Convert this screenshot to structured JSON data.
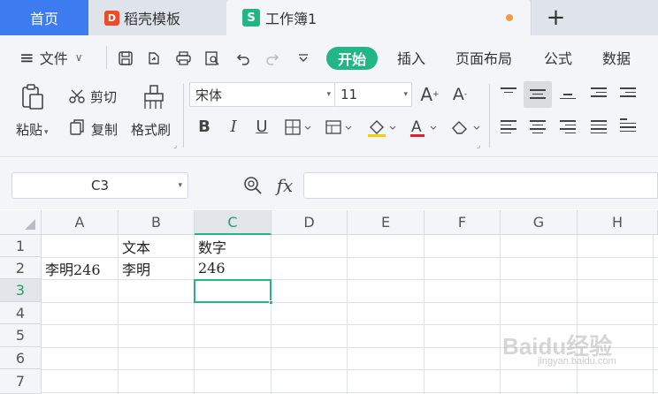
{
  "tabs": {
    "home": "首页",
    "template_logo": "D",
    "template": "稻壳模板",
    "book_logo": "S",
    "book": "工作簿1",
    "plus": "+"
  },
  "menu": {
    "hamburger": "≡",
    "file": "文件",
    "file_arrow": "∨",
    "start": "开始",
    "insert": "插入",
    "page_layout": "页面布局",
    "formula": "公式",
    "data": "数据"
  },
  "ribbon": {
    "cut": "剪切",
    "paste": "粘贴",
    "paste_arrow": "▾",
    "copy": "复制",
    "format_painter": "格式刷",
    "font_name": "宋体",
    "font_size": "11",
    "bold": "B",
    "italic": "I",
    "underline": "U",
    "font_color_letter": "A"
  },
  "formula_bar": {
    "name_box": "C3",
    "fx": "fx",
    "content": ""
  },
  "grid": {
    "columns": [
      "A",
      "B",
      "C",
      "D",
      "E",
      "F",
      "G",
      "H"
    ],
    "rows": [
      "1",
      "2",
      "3",
      "4",
      "5",
      "6",
      "7"
    ],
    "cells": {
      "B1": "文本",
      "C1": "数字",
      "A2": "李明246",
      "B2": "李明",
      "C2": "246"
    },
    "selected_cell": "C3"
  },
  "watermark": {
    "main": "Baidu经验",
    "sub": "jingyan.baidu.com"
  },
  "colors": {
    "accent_green": "#21b683",
    "home_tab_blue": "#3d7bf0",
    "template_red": "#ee4b2b",
    "unsaved_dot": "#f29a45"
  }
}
